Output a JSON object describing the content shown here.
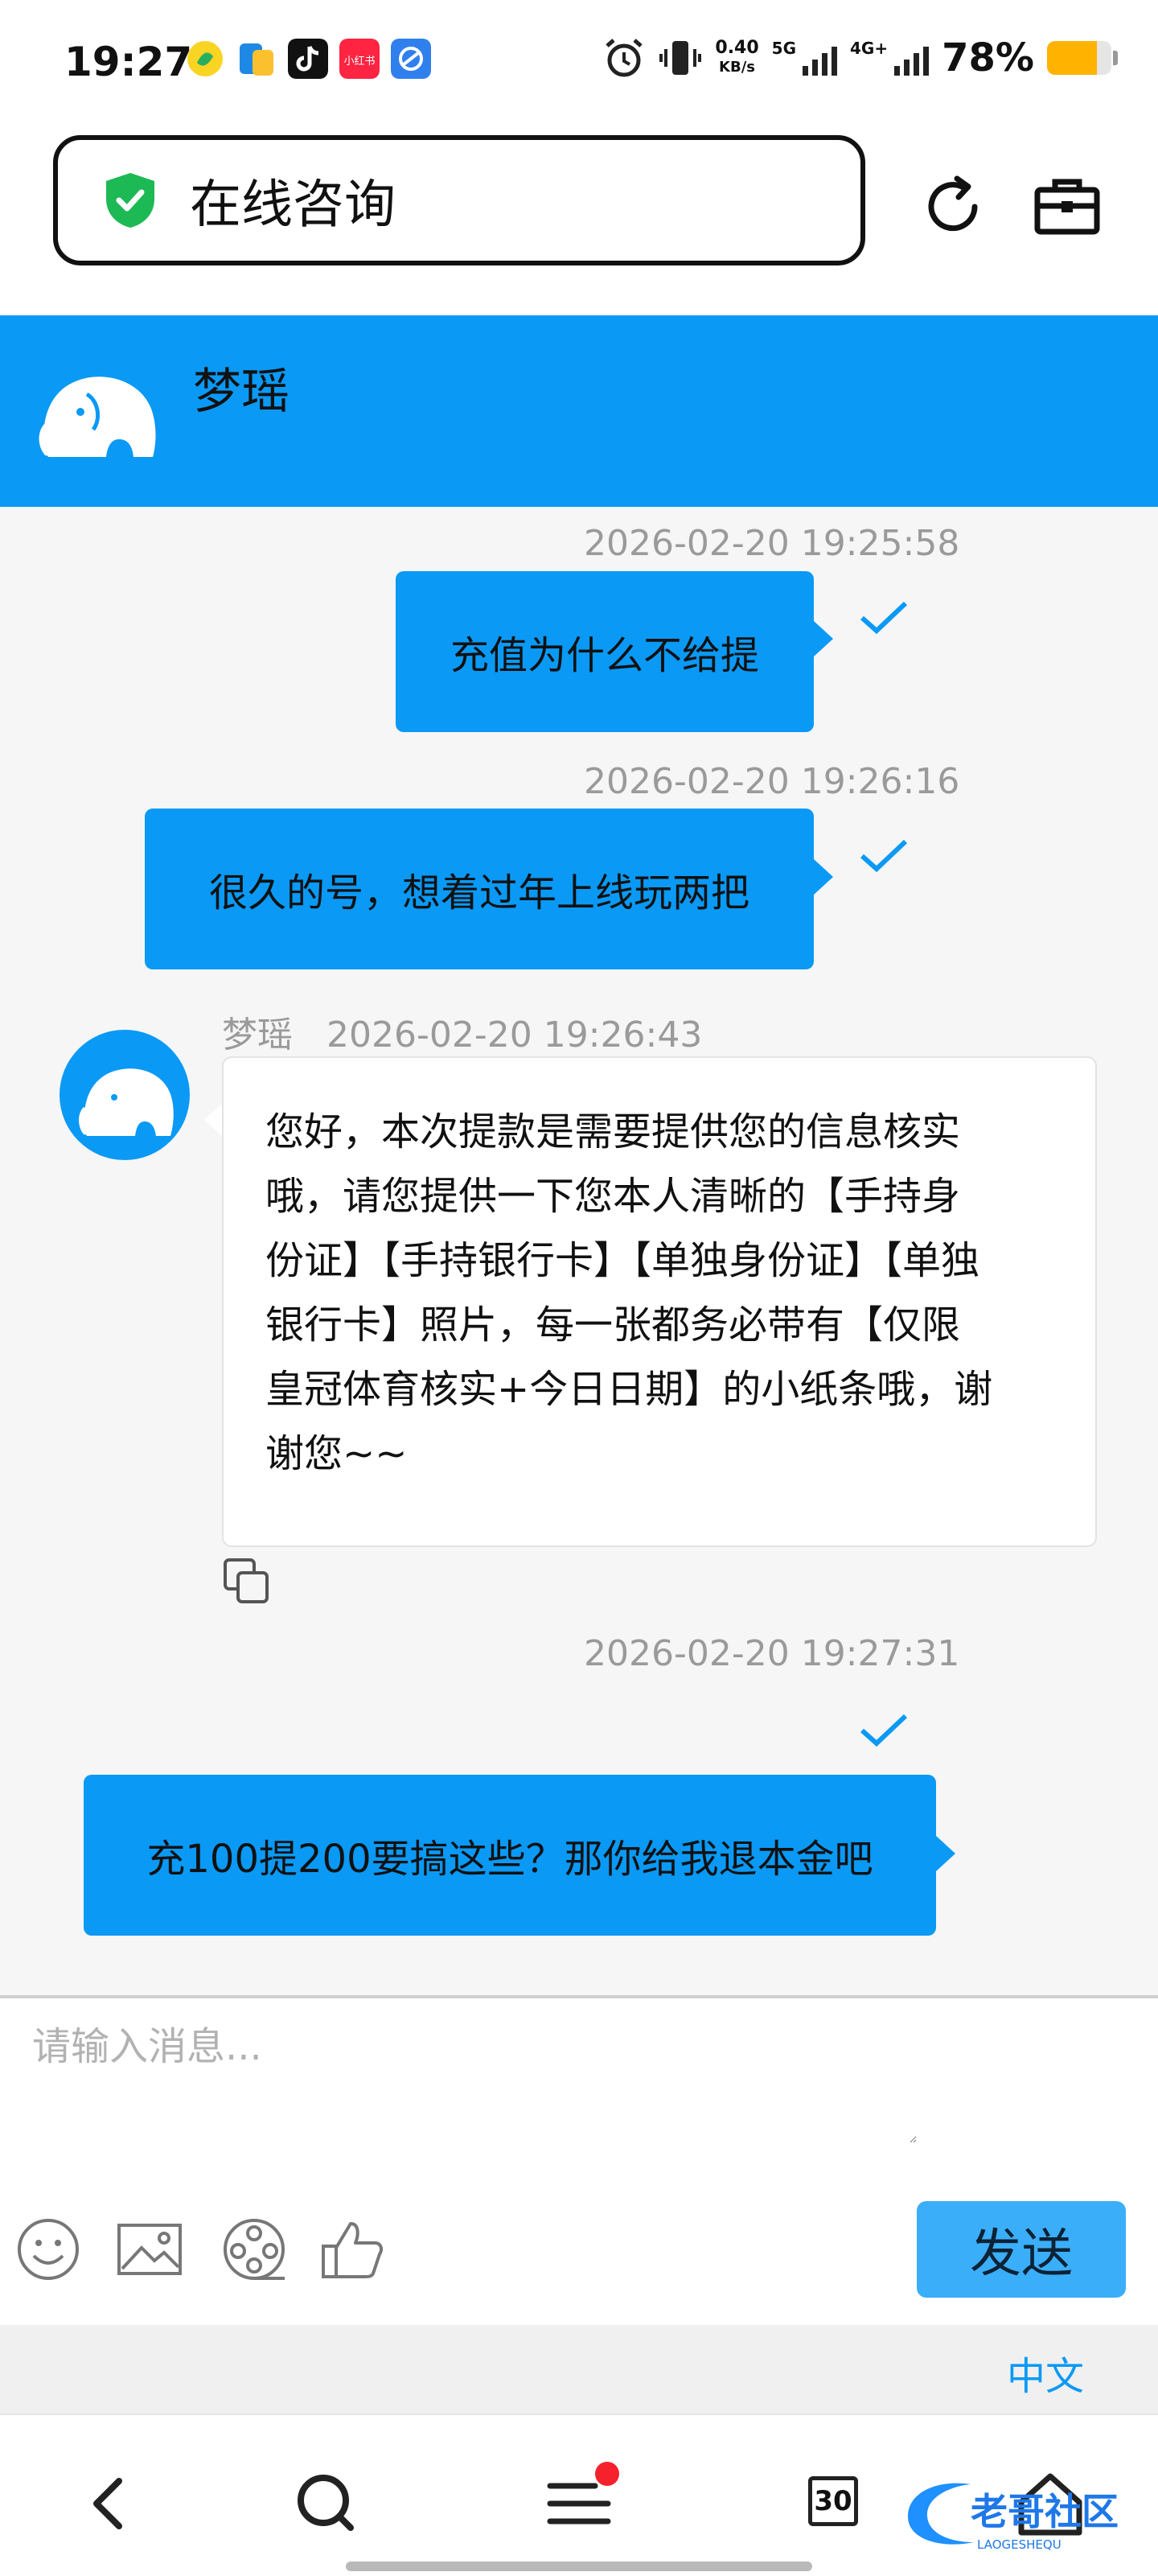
{
  "status_bar": {
    "time": "19:27",
    "net_speed_value": "0.40",
    "net_speed_unit": "KB/s",
    "net_5g": "5G",
    "net_4g": "4G+",
    "battery_percent": "78%",
    "battery_level": 0.78,
    "app_icons": [
      "qq-music-icon",
      "files-icon",
      "tiktok-icon",
      "xiaohongshu-icon",
      "browser-icon"
    ],
    "xhs_label": "小红书"
  },
  "address_bar": {
    "title": "在线咨询"
  },
  "chat_header": {
    "agent_name": "梦瑶"
  },
  "messages": [
    {
      "type": "outgoing",
      "time": "2026-02-20 19:25:58",
      "text": "充值为什么不给提"
    },
    {
      "type": "outgoing",
      "time": "2026-02-20 19:26:16",
      "text": "很久的号，想着过年上线玩两把"
    },
    {
      "type": "incoming",
      "sender": "梦瑶",
      "time": "2026-02-20 19:26:43",
      "lines": [
        "您好，本次提款是需要提供您的信息核实",
        "哦，请您提供一下您本人清晰的【手持身",
        "份证】【手持银行卡】【单独身份证】【单独",
        "银行卡】照片，每一张都务必带有【仅限",
        "皇冠体育核实+今日日期】的小纸条哦，谢",
        "谢您~~"
      ]
    },
    {
      "type": "outgoing",
      "time": "2026-02-20 19:27:31",
      "text": "充100提200要搞这些？那你给我退本金吧"
    }
  ],
  "composer": {
    "placeholder": "请输入消息...",
    "send_label": "发送",
    "language": "中文"
  },
  "nav": {
    "tab_count": "30",
    "watermark_text": "老哥社区",
    "watermark_sub": "LAOGESHEQU"
  },
  "colors": {
    "accent": "#0a99f5",
    "send_button": "#3baef9",
    "secure_shield": "#1db954",
    "notification_dot": "#f5222d",
    "battery": "#ffb300"
  }
}
